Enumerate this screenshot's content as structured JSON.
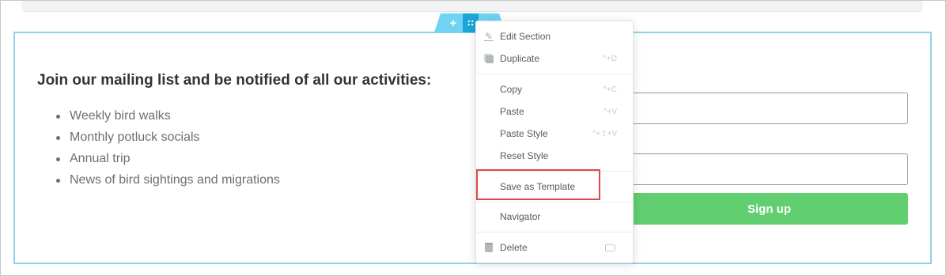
{
  "section": {
    "add_icon": "plus-icon",
    "move_icon": "drag-handle-icon",
    "add_glyph": "+",
    "move_glyph": "∷"
  },
  "content": {
    "heading": "Join our mailing list and be notified of all our activities:",
    "list": [
      "Weekly bird walks",
      "Monthly potluck socials",
      "Annual trip",
      "News of bird sightings and migrations"
    ]
  },
  "form": {
    "signup_label": "Sign up",
    "signup_color": "#61ce70"
  },
  "context_menu": {
    "items": [
      {
        "label": "Edit Section",
        "icon": "pencil-icon",
        "shortcut": ""
      },
      {
        "label": "Duplicate",
        "icon": "duplicate-icon",
        "shortcut": "^+D"
      },
      {
        "label": "Copy",
        "icon": "",
        "shortcut": "^+C"
      },
      {
        "label": "Paste",
        "icon": "",
        "shortcut": "^+V"
      },
      {
        "label": "Paste Style",
        "icon": "",
        "shortcut": "^+⇧+V"
      },
      {
        "label": "Reset Style",
        "icon": "",
        "shortcut": ""
      },
      {
        "label": "Save as Template",
        "icon": "",
        "shortcut": ""
      },
      {
        "label": "Navigator",
        "icon": "",
        "shortcut": ""
      },
      {
        "label": "Delete",
        "icon": "trash-icon",
        "shortcut": ""
      }
    ],
    "highlight_color": "#e04848"
  },
  "colors": {
    "section_border": "#8fd3ea",
    "handle_blue": "#6fd3f2"
  }
}
